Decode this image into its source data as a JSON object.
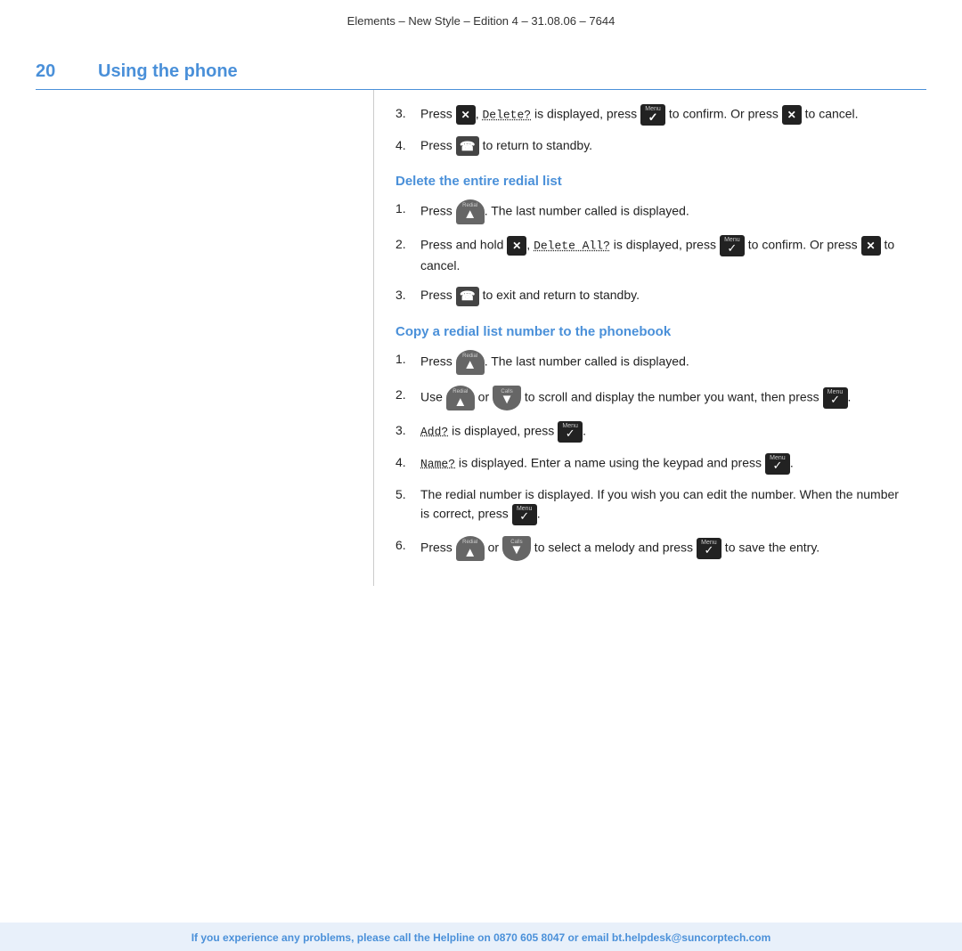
{
  "header": {
    "text": "Elements – New Style – Edition 4 – 31.08.06 – 7644"
  },
  "page": {
    "number": "20",
    "title": "Using the phone"
  },
  "sections": [
    {
      "id": "delete-redial",
      "title": null,
      "steps": [
        {
          "num": "3.",
          "text_parts": [
            "Press ",
            "X_BTN",
            ", ",
            "Delete?",
            " is displayed, press ",
            "CHECK_BTN",
            " to confirm. Or press ",
            "X_BTN",
            " to cancel."
          ]
        },
        {
          "num": "4.",
          "text_parts": [
            "Press ",
            "PHONE_BTN",
            " to return to standby."
          ]
        }
      ]
    },
    {
      "id": "delete-entire",
      "title": "Delete the entire redial list",
      "steps": [
        {
          "num": "1.",
          "text_parts": [
            "Press ",
            "REDIAL_BTN",
            ". The last number called is displayed."
          ]
        },
        {
          "num": "2.",
          "text_parts": [
            "Press and hold ",
            "X_BTN",
            ", ",
            "Delete All?",
            " is displayed, press ",
            "CHECK_BTN",
            " to confirm. Or press ",
            "X_BTN",
            " to cancel."
          ]
        },
        {
          "num": "3.",
          "text_parts": [
            "Press ",
            "PHONE_BTN",
            " to exit and return to standby."
          ]
        }
      ]
    },
    {
      "id": "copy-redial",
      "title": "Copy a redial list number to the phonebook",
      "steps": [
        {
          "num": "1.",
          "text_parts": [
            "Press ",
            "REDIAL_BTN",
            ". The last number called is displayed."
          ]
        },
        {
          "num": "2.",
          "text_parts": [
            "Use ",
            "REDIAL_BTN",
            " or ",
            "CALLS_BTN",
            " to scroll and display the number you want, then press ",
            "CHECK_BTN",
            "."
          ]
        },
        {
          "num": "3.",
          "text_parts": [
            "Add?",
            " is displayed, press ",
            "CHECK_BTN",
            "."
          ]
        },
        {
          "num": "4.",
          "text_parts": [
            "Name?",
            " is displayed. Enter a name using the keypad and press ",
            "CHECK_BTN",
            "."
          ]
        },
        {
          "num": "5.",
          "text_parts": [
            "The redial number is displayed. If you wish you can edit the number. When the number is correct, press ",
            "CHECK_BTN",
            "."
          ]
        },
        {
          "num": "6.",
          "text_parts": [
            "Press ",
            "REDIAL_BTN",
            " or ",
            "CALLS_BTN",
            " to select a melody and press ",
            "CHECK_BTN",
            " to save the entry."
          ]
        }
      ]
    }
  ],
  "footer": {
    "text": "If you experience any problems, please call the Helpline on 0870 605 8047 or email bt.helpdesk@suncorptech.com"
  },
  "icons": {
    "x_label": "✕",
    "check_label": "✓",
    "menu_label": "Menu",
    "phone_label": "☎",
    "redial_label": "Redial",
    "calls_label": "Calls"
  }
}
